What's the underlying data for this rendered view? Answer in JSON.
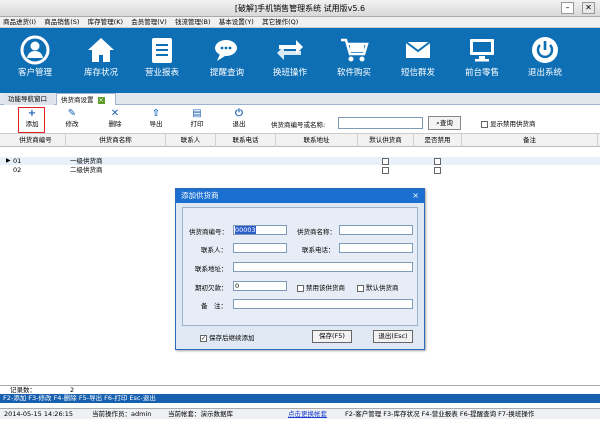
{
  "window": {
    "title": "[破解]手机销售管理系统 试用版v5.6"
  },
  "menu": [
    "商品进货(I)",
    "商品销售(S)",
    "库存管理(K)",
    "会员管理(V)",
    "钱流管理(B)",
    "基本设置(Y)",
    "其它操作(Q)"
  ],
  "toolbar": [
    {
      "label": "客户管理",
      "icon": "user-circle-icon"
    },
    {
      "label": "库存状况",
      "icon": "home-icon"
    },
    {
      "label": "营业报表",
      "icon": "report-icon"
    },
    {
      "label": "提醒查询",
      "icon": "chat-icon"
    },
    {
      "label": "换班操作",
      "icon": "swap-icon"
    },
    {
      "label": "软件购买",
      "icon": "cart-icon"
    },
    {
      "label": "短信群发",
      "icon": "envelope-icon"
    },
    {
      "label": "前台零售",
      "icon": "monitor-icon"
    },
    {
      "label": "退出系统",
      "icon": "power-icon"
    }
  ],
  "tabs": {
    "nav": "功能导航窗口",
    "active": "供货商设置"
  },
  "subtoolbar": {
    "add": "添加",
    "edit": "修改",
    "delete": "删除",
    "export": "导出",
    "print": "打印",
    "exit": "退出"
  },
  "search": {
    "label": "供货商编号或名称:",
    "button": "查询",
    "show_disabled": "显示禁用供货商"
  },
  "grid": {
    "columns": [
      "供货商编号",
      "供货商名称",
      "联系人",
      "联系电话",
      "联系地址",
      "默认供货商",
      "是否禁用",
      "备注"
    ],
    "rows": [
      {
        "code": "01",
        "name": "一级供货商"
      },
      {
        "code": "02",
        "name": "二级供货商"
      }
    ],
    "record_label": "记录数：",
    "record_count": "2"
  },
  "hint": "F2-添加 F3-修改 F4-删除 F5-导出 F6-打印 Esc-退出",
  "status": {
    "datetime": "2014-05-15 14:26:15",
    "operator": "当前操作员：admin",
    "account": "当前帐套：演示数据库",
    "link": "点击更换帐套",
    "shortcuts": "F2-客户管理 F3-库存状况 F4-营业报表 F6-提醒查询 F7-换班操作"
  },
  "dialog": {
    "title": "添加供货商",
    "code_label": "供货商编号：",
    "code_value": "00003",
    "name_label": "供货商名称：",
    "contact_label": "联系人：",
    "phone_label": "联系电话：",
    "address_label": "联系地址：",
    "arrears_label": "期初欠款：",
    "arrears_value": "0",
    "disable_label": "禁用该供货商",
    "default_label": "默认供货商",
    "remark_label": "备　注：",
    "keep_label": "保存后继续添加",
    "save_button": "保存(F5)",
    "exit_button": "退出(Esc)"
  },
  "colors": {
    "toolbar": "#0f6fb5",
    "dialog_title": "#1a6fd0",
    "annotation": "#e02020",
    "hint_bar": "#1860b0"
  }
}
